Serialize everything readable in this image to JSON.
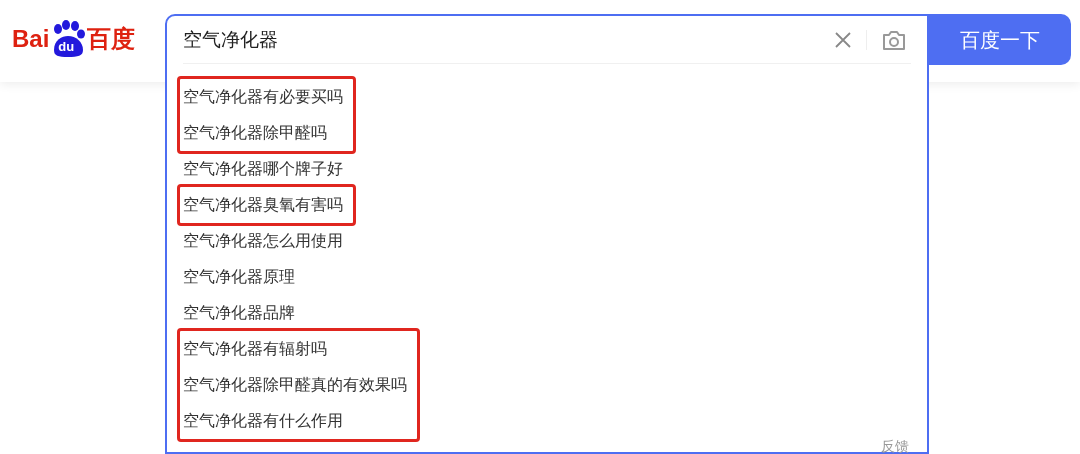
{
  "logo": {
    "left": "Bai",
    "paw": "du",
    "right": "百度"
  },
  "search": {
    "value": "空气净化器"
  },
  "search_button": "百度一下",
  "suggestions": [
    {
      "text": "空气净化器有必要买吗",
      "highlighted": true
    },
    {
      "text": "空气净化器除甲醛吗",
      "highlighted": true
    },
    {
      "text": "空气净化器哪个牌子好",
      "highlighted": false
    },
    {
      "text": "空气净化器臭氧有害吗",
      "highlighted": true
    },
    {
      "text": "空气净化器怎么用使用",
      "highlighted": false
    },
    {
      "text": "空气净化器原理",
      "highlighted": false
    },
    {
      "text": "空气净化器品牌",
      "highlighted": false
    },
    {
      "text": "空气净化器有辐射吗",
      "highlighted": true
    },
    {
      "text": "空气净化器除甲醛真的有效果吗",
      "highlighted": true
    },
    {
      "text": "空气净化器有什么作用",
      "highlighted": true
    }
  ],
  "feedback": "反馈"
}
